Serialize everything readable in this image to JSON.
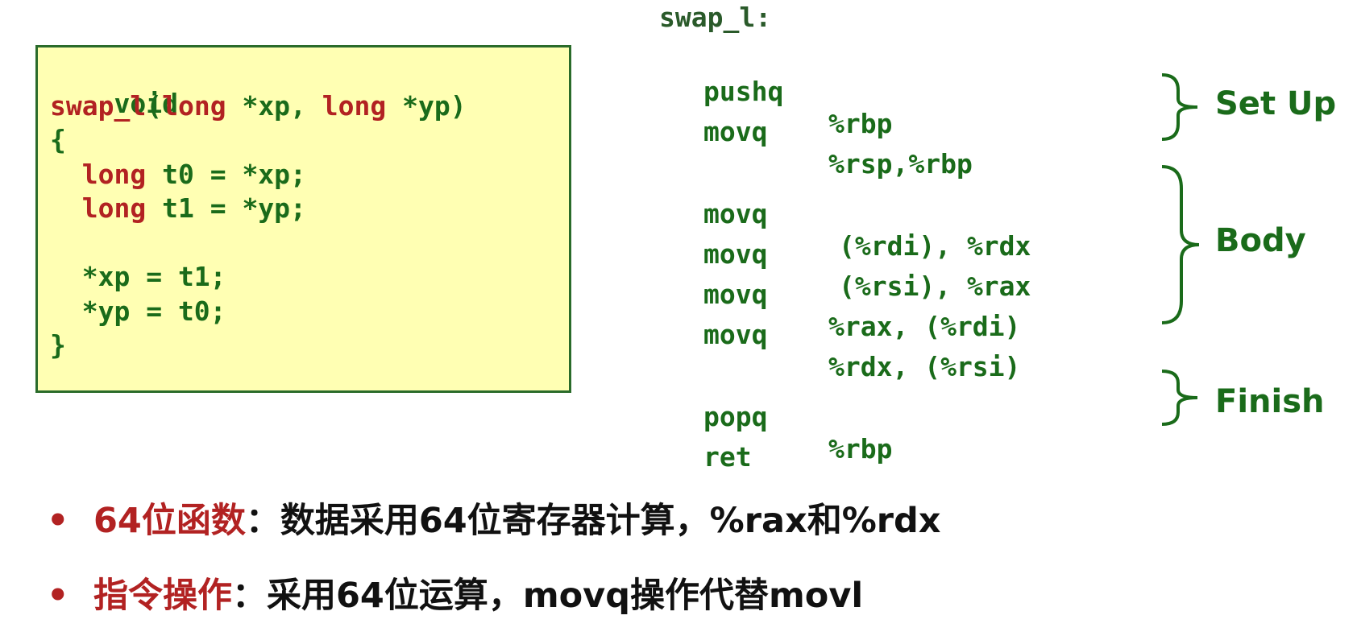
{
  "c_code": {
    "lines": [
      [
        {
          "t": "void",
          "c": "green"
        }
      ],
      [
        {
          "t": "swap_l",
          "c": "red"
        },
        {
          "t": "(",
          "c": "green"
        },
        {
          "t": "long",
          "c": "red"
        },
        {
          "t": " *xp, ",
          "c": "green"
        },
        {
          "t": "long",
          "c": "red"
        },
        {
          "t": " *yp)",
          "c": "green"
        }
      ],
      [
        {
          "t": "{",
          "c": "green"
        }
      ],
      [
        {
          "t": "  ",
          "c": "green"
        },
        {
          "t": "long",
          "c": "red"
        },
        {
          "t": " t0 = *xp;",
          "c": "green"
        }
      ],
      [
        {
          "t": "  ",
          "c": "green"
        },
        {
          "t": "long",
          "c": "red"
        },
        {
          "t": " t1 = *yp;",
          "c": "green"
        }
      ],
      [
        {
          "t": "",
          "c": "green"
        }
      ],
      [
        {
          "t": "  *xp = t1;",
          "c": "green"
        }
      ],
      [
        {
          "t": "  *yp = t0;",
          "c": "green"
        }
      ],
      [
        {
          "t": "}",
          "c": "green"
        }
      ]
    ]
  },
  "assembly": {
    "label": "swap_l:",
    "instructions": [
      {
        "op": "pushq",
        "args": "%rbp"
      },
      {
        "op": "movq",
        "args": "%rsp,%rbp"
      },
      {
        "op": "movq",
        "args": "(%rdi), %rdx"
      },
      {
        "op": "movq",
        "args": "(%rsi), %rax"
      },
      {
        "op": "movq",
        "args": "%rax, (%rdi)"
      },
      {
        "op": "movq",
        "args": "%rdx, (%rsi)"
      },
      {
        "op": "popq",
        "args": "%rbp"
      },
      {
        "op": "ret",
        "args": ""
      }
    ]
  },
  "sections": {
    "setup": "Set Up",
    "body": "Body",
    "finish": "Finish"
  },
  "bullets": [
    {
      "marker": "•",
      "head": "64位函数",
      "text": "：数据采用64位寄存器计算，%rax和%rdx"
    },
    {
      "marker": "•",
      "head": "指令操作",
      "text": "：采用64位运算，movq操作代替movl"
    }
  ],
  "colors": {
    "code_green": "#1a6b1a",
    "keyword_red": "#b22222",
    "box_fill": "#ffffb3",
    "box_border": "#2a6b2a"
  }
}
